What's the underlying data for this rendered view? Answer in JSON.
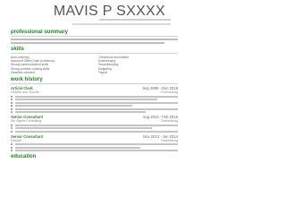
{
  "header": {
    "name": "MAVIS P SXXXX"
  },
  "sections": {
    "summary": "professional summary",
    "skills": "skills",
    "work": "work history",
    "education": "education"
  },
  "skills_left": [
    "Auto-ordering",
    "Microsoft Office Suite proficiency",
    "Strong communication skills",
    "Strong problem-solving skills",
    "Deadline-oriented"
  ],
  "skills_right": [
    "Checkbook accountant",
    "Bookkeeping",
    "Recordkeeping",
    "Budgeting",
    "Payroll"
  ],
  "jobs": [
    {
      "title": "Article Clerk",
      "dates": "Sep 2008 - Dec 2018",
      "company": "Deloitte and Touche",
      "location": "Greensburg"
    },
    {
      "title": "Senior Consultant",
      "dates": "Aug 2013 - Feb 2015",
      "company": "Mu Sigma Consulting",
      "location": "Greensburg"
    },
    {
      "title": "Senior Consultant",
      "dates": "Nov 2013 - Jun 2014",
      "company": "Deloitte",
      "location": "Greensburg"
    }
  ]
}
